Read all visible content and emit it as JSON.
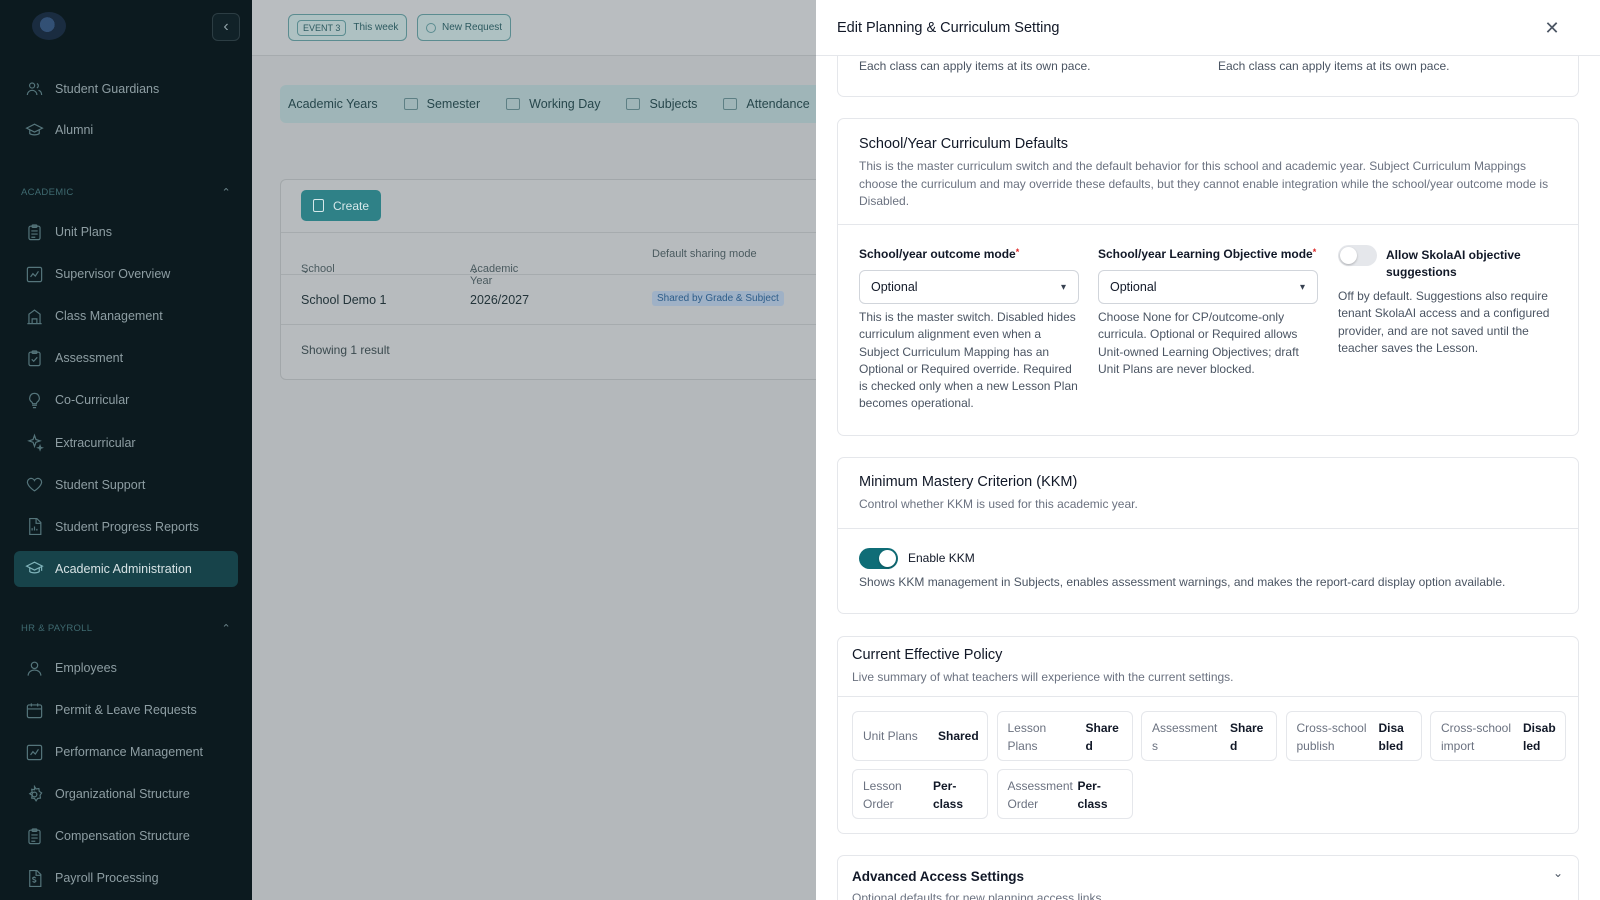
{
  "sidebar": {
    "items_top": [
      {
        "label": "Student Guardians",
        "icon": "users-icon"
      },
      {
        "label": "Alumni",
        "icon": "graduation-icon"
      }
    ],
    "academic_section": "ACADEMIC",
    "academic_items": [
      {
        "label": "Unit Plans",
        "icon": "clipboard-icon"
      },
      {
        "label": "Supervisor Overview",
        "icon": "chart-icon"
      },
      {
        "label": "Class Management",
        "icon": "building-icon"
      },
      {
        "label": "Assessment",
        "icon": "clipboard-check-icon"
      },
      {
        "label": "Co-Curricular",
        "icon": "lightbulb-icon"
      },
      {
        "label": "Extracurricular",
        "icon": "sparkles-icon"
      },
      {
        "label": "Student Support",
        "icon": "heart-icon"
      },
      {
        "label": "Student Progress Reports",
        "icon": "report-icon"
      },
      {
        "label": "Academic Administration",
        "icon": "graduation-cap-icon",
        "active": true
      }
    ],
    "hr_section": "HR & PAYROLL",
    "hr_items": [
      {
        "label": "Employees",
        "icon": "user-icon"
      },
      {
        "label": "Permit & Leave Requests",
        "icon": "calendar-icon"
      },
      {
        "label": "Performance Management",
        "icon": "chart-icon"
      },
      {
        "label": "Organizational Structure",
        "icon": "gear-icon"
      },
      {
        "label": "Compensation Structure",
        "icon": "clipboard-icon"
      },
      {
        "label": "Payroll Processing",
        "icon": "dollar-doc-icon"
      }
    ]
  },
  "topbar": {
    "event_tag": "EVENT 3",
    "event_label": "This week",
    "new_request": "New Request"
  },
  "tabs": [
    "Academic Years",
    "Semester",
    "Working Day",
    "Subjects",
    "Attendance"
  ],
  "table": {
    "create_label": "Create",
    "headers": [
      "School",
      "Academic Year",
      "Default sharing mode"
    ],
    "row": {
      "school": "School Demo 1",
      "year": "2026/2027",
      "sharing": "Shared by Grade & Subject"
    },
    "showing": "Showing 1 result"
  },
  "drawer": {
    "title": "Edit Planning & Curriculum Setting",
    "top_card": {
      "left_text": "Each class can apply items at its own pace.",
      "right_text": "Each class can apply items at its own pace."
    },
    "defaults": {
      "title": "School/Year Curriculum Defaults",
      "description": "This is the master curriculum switch and the default behavior for this school and academic year. Subject Curriculum Mappings choose the curriculum and may override these defaults, but they cannot enable integration while the school/year outcome mode is Disabled.",
      "outcome_label": "School/year outcome mode",
      "outcome_value": "Optional",
      "outcome_help": "This is the master switch. Disabled hides curriculum alignment even when a Subject Curriculum Mapping has an Optional or Required override. Required is checked only when a new Lesson Plan becomes operational.",
      "lo_label": "School/year Learning Objective mode",
      "lo_value": "Optional",
      "lo_help": "Choose None for CP/outcome-only curricula. Optional or Required allows Unit-owned Learning Objectives; draft Unit Plans are never blocked.",
      "ai_label": "Allow SkolaAI objective suggestions",
      "ai_enabled": false,
      "ai_help": "Off by default. Suggestions also require tenant SkolaAI access and a configured provider, and are not saved until the teacher saves the Lesson."
    },
    "kkm": {
      "title": "Minimum Mastery Criterion (KKM)",
      "description": "Control whether KKM is used for this academic year.",
      "toggle_label": "Enable KKM",
      "enabled": true,
      "help": "Shows KKM management in Subjects, enables assessment warnings, and makes the report-card display option available."
    },
    "policy": {
      "title": "Current Effective Policy",
      "description": "Live summary of what teachers will experience with the current settings.",
      "cells": [
        {
          "k1": "Unit Plans",
          "k2": "",
          "v1": "Shared",
          "v2": ""
        },
        {
          "k1": "Lesson",
          "k2": "Plans",
          "v1": "Share",
          "v2": "d"
        },
        {
          "k1": "Assessment",
          "k2": "s",
          "v1": "Share",
          "v2": "d"
        },
        {
          "k1": "Cross-school",
          "k2": "publish",
          "v1": "Disa",
          "v2": "bled"
        },
        {
          "k1": "Cross-school",
          "k2": "import",
          "v1": "Disab",
          "v2": "led"
        },
        {
          "k1": "Lesson",
          "k2": "Order",
          "v1": "Per-",
          "v2": "class"
        },
        {
          "k1": "Assessment",
          "k2": "Order",
          "v1": "Per-",
          "v2": "class"
        }
      ]
    },
    "advanced": {
      "title": "Advanced Access Settings",
      "description": "Optional defaults for new planning access links."
    }
  },
  "colors": {
    "accent": "#0f6d77",
    "sidebar_bg": "#0c1a1f",
    "required": "#dc2626"
  }
}
